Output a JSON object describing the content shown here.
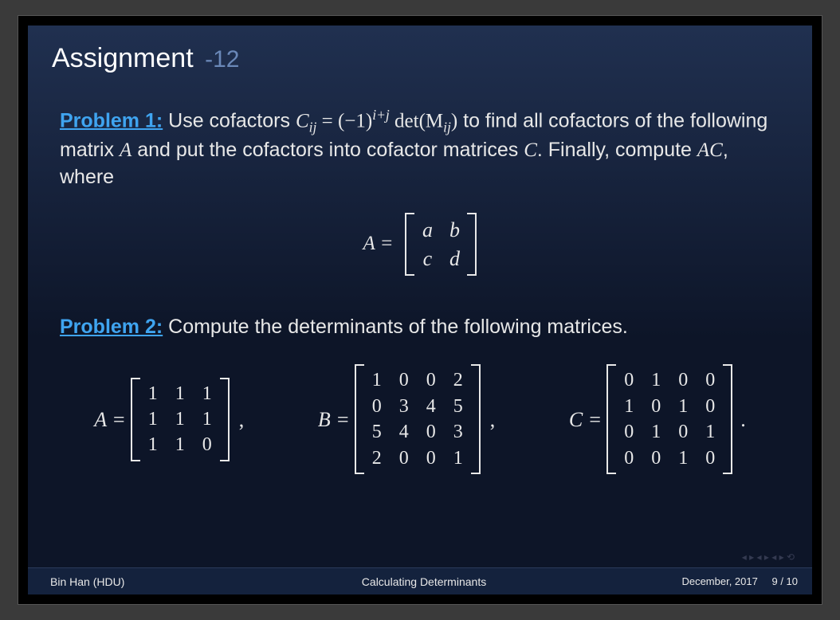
{
  "title": {
    "main": "Assignment",
    "num": "-12"
  },
  "problem1": {
    "label": "Problem 1:",
    "text1": " Use cofactors ",
    "formula_var": "C",
    "formula_sub": "ij",
    "eq": " = ",
    "neg1": "(−1)",
    "neg1_sup": "i+j",
    "det": " det",
    "detArg": "(M",
    "detSub": "ij",
    "detClose": ")",
    "text2": " to find all cofactors of the following matrix ",
    "A": "A",
    "text3": " and put the cofactors into cofactor matrices ",
    "C": "C",
    "text4": ". Finally, compute ",
    "AC": "AC",
    "text5": ", where"
  },
  "eqA": {
    "lhs": "A =",
    "rows": [
      [
        "a",
        "b"
      ],
      [
        "c",
        "d"
      ]
    ]
  },
  "problem2": {
    "label": "Problem 2:",
    "text": " Compute the determinants of the following matrices."
  },
  "matA": {
    "lhs": "A =",
    "rows": [
      [
        "1",
        "1",
        "1"
      ],
      [
        "1",
        "1",
        "1"
      ],
      [
        "1",
        "1",
        "0"
      ]
    ]
  },
  "matB": {
    "lhs": "B =",
    "rows": [
      [
        "1",
        "0",
        "0",
        "2"
      ],
      [
        "0",
        "3",
        "4",
        "5"
      ],
      [
        "5",
        "4",
        "0",
        "3"
      ],
      [
        "2",
        "0",
        "0",
        "1"
      ]
    ]
  },
  "matC": {
    "lhs": "C =",
    "rows": [
      [
        "0",
        "1",
        "0",
        "0"
      ],
      [
        "1",
        "0",
        "1",
        "0"
      ],
      [
        "0",
        "1",
        "0",
        "1"
      ],
      [
        "0",
        "0",
        "1",
        "0"
      ]
    ]
  },
  "footer": {
    "author": "Bin Han  (HDU)",
    "title": "Calculating Determinants",
    "date": "December, 2017",
    "page": "9 / 10"
  }
}
